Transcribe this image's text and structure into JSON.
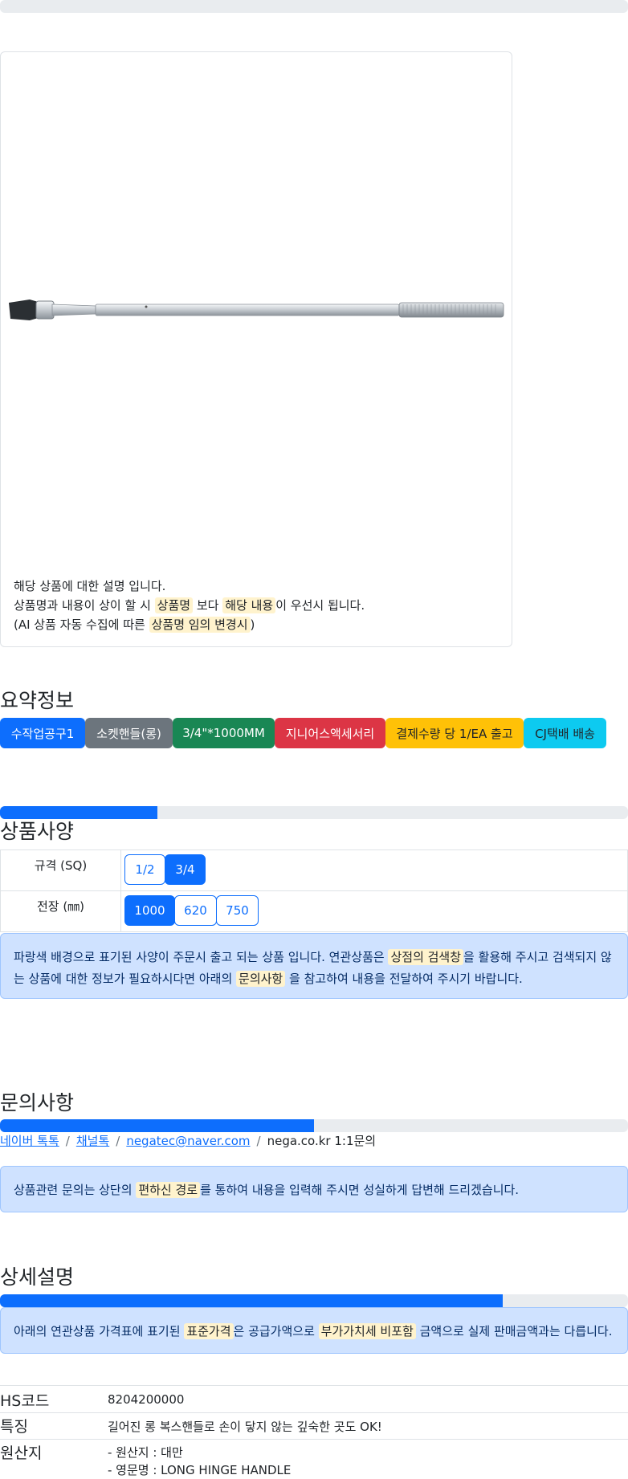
{
  "product": {
    "image_alt": "socket handle long ratchet wrench",
    "desc_line1": "해당 상품에 대한 설명 입니다.",
    "desc_line2_pre": "상품명과 내용이 상이 할 시",
    "desc_line2_mark1": "상품명",
    "desc_line2_mid": "보다",
    "desc_line2_mark2": "해당 내용",
    "desc_line2_post": "이 우선시 됩니다.",
    "desc_line3_pre": "(AI 상품 자동 수집에 따른",
    "desc_line3_mark": "상품명 임의 변경시",
    "desc_line3_post": ")"
  },
  "summary": {
    "title": "요약정보",
    "badges": [
      {
        "label": "수작업공구1",
        "color": "#0d6efd"
      },
      {
        "label": "소켓핸들(롱)",
        "color": "#6c757d"
      },
      {
        "label": "3/4\"*1000MM",
        "color": "#198754"
      },
      {
        "label": "지니어스액세서리",
        "color": "#dc3545"
      },
      {
        "label": "결제수량 당 1/EA 출고",
        "color": "#ffc107"
      },
      {
        "label": "CJ택배 배송",
        "color": "#0dcaf0"
      }
    ]
  },
  "spec": {
    "title": "상품사양",
    "progress_fraction": 0.25,
    "rows": [
      {
        "label": "규격 (SQ)",
        "options": [
          "1/2",
          "3/4"
        ],
        "selected": "3/4"
      },
      {
        "label": "전장 (㎜)",
        "options": [
          "1000",
          "620",
          "750"
        ],
        "selected": "1000"
      }
    ],
    "notice_pre": "파랑색 배경으로 표기된 사양이 주문시 출고 되는 상품 입니다. 연관상품은",
    "notice_mark1": "상점의 검색창",
    "notice_mid1": "을 활용해 주시고 검색되지 않",
    "notice_line2_pre": "는 상품에 대한 정보가 필요하시다면 아래의",
    "notice_mark2": "문의사항",
    "notice_post": "을 참고하여 내용을 전달하여 주시기 바랍니다."
  },
  "inquiry": {
    "title": "문의사항",
    "progress_fraction": 0.5,
    "links": [
      "네이버 톡톡",
      "채널톡",
      "negatec@naver.com"
    ],
    "plain": "nega.co.kr 1:1문의",
    "separator": "/",
    "notice_pre": "상품관련 문의는 상단의",
    "notice_mark": "편하신 경로",
    "notice_post": "를 통하여 내용을 입력해 주시면 성실하게 답변해 드리겠습니다."
  },
  "detail": {
    "title": "상세설명",
    "progress_fraction": 0.8,
    "notice_pre": "아래의 연관상품 가격표에 표기된",
    "notice_mark1": "표준가격",
    "notice_mid": "은 공급가액으로",
    "notice_mark2": "부가가치세 비포함",
    "notice_post": "금액으로 실제 판매금액과는 다릅니다.",
    "rows": [
      {
        "label": "HS코드",
        "value": "8204200000"
      },
      {
        "label": "특징",
        "value": "길어진 롱 복스핸들로 손이 닿지 않는 깊숙한 곳도 OK!"
      },
      {
        "label": "원산지",
        "value": "- 원산지 : 대만",
        "value2": "- 영문명 : LONG HINGE HANDLE"
      }
    ]
  }
}
